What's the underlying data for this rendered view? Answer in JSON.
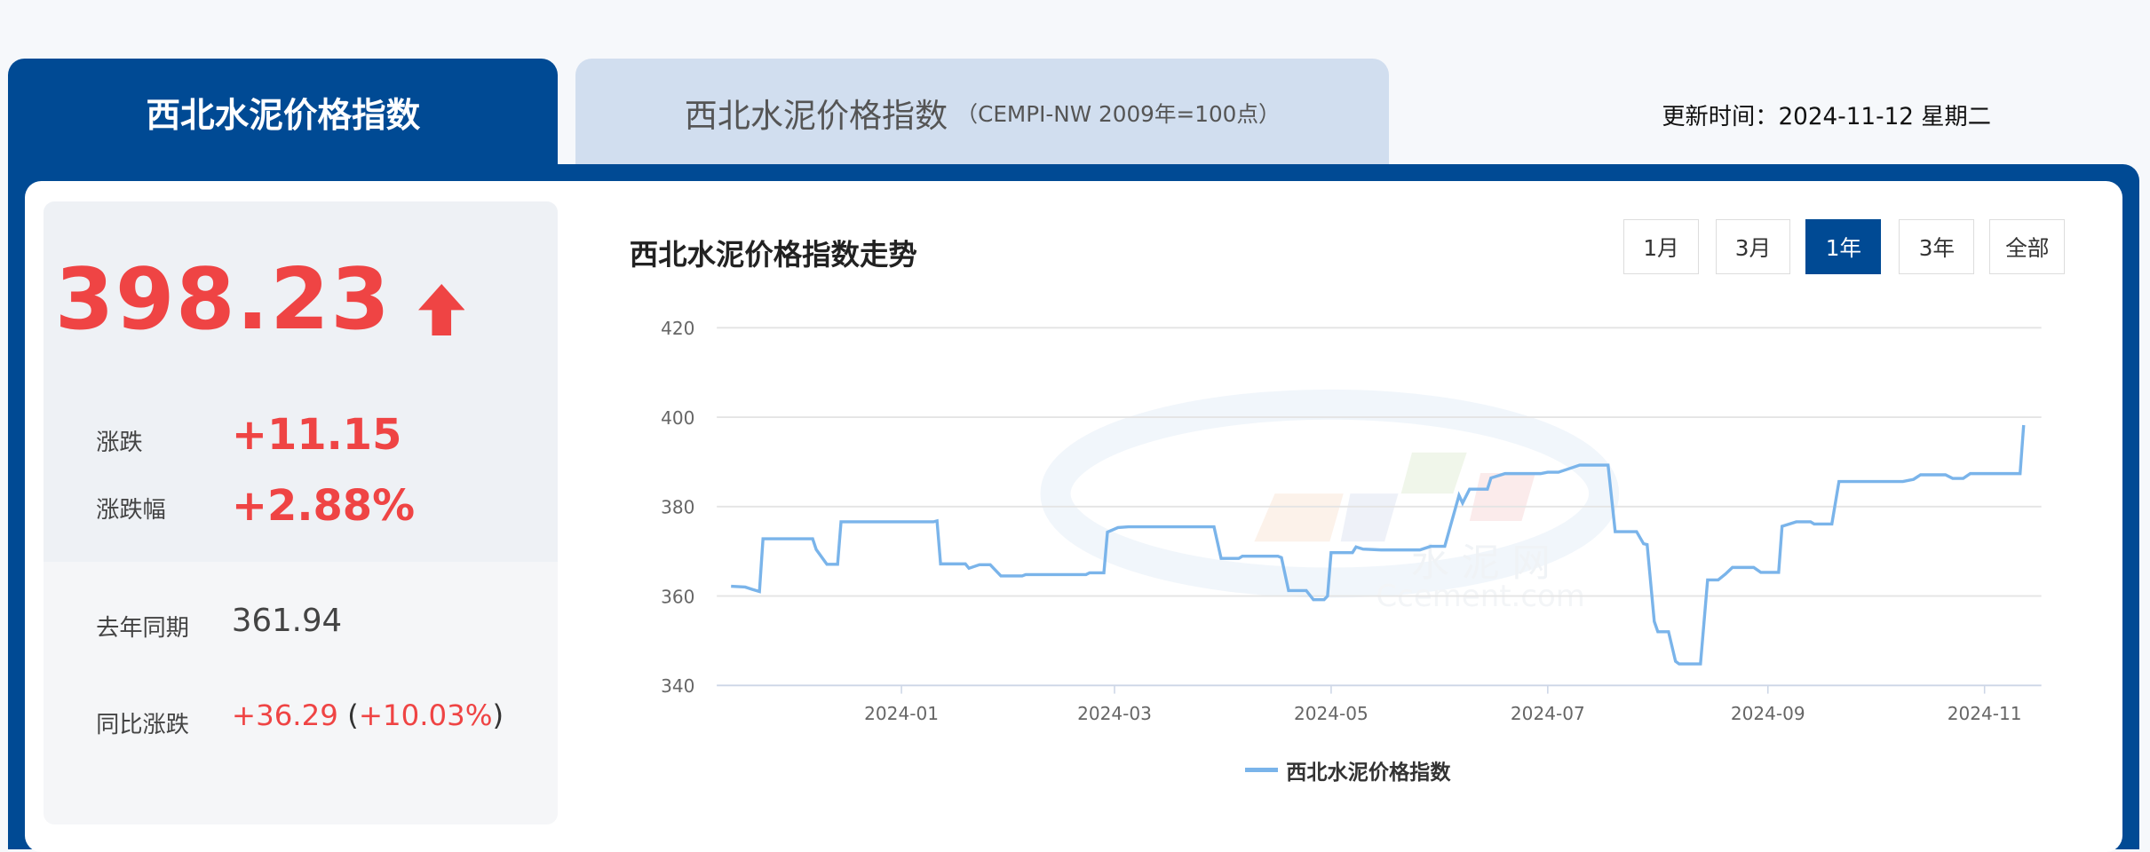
{
  "tabs": [
    {
      "label": "西北水泥价格指数",
      "active": true
    },
    {
      "label": "西北水泥价格指数",
      "sub": "（CEMPI-NW 2009年=100点）",
      "active": false
    }
  ],
  "update": "更新时间：2024-11-12 星期二",
  "summary": {
    "index": "398.23",
    "direction": "up",
    "direction_icon": "arrow-up-icon",
    "change_label": "涨跌",
    "change": "+11.15",
    "pct_label": "涨跌幅",
    "pct": "+2.88%",
    "yoy_label": "去年同期",
    "yoy": "361.94",
    "yoy_change_label": "同比涨跌",
    "yoy_change": "+36.29",
    "yoy_pct_open": " (",
    "yoy_pct": "+10.03%",
    "yoy_pct_close": ")"
  },
  "chart_title": "西北水泥价格指数走势",
  "ranges": [
    {
      "label": "1月"
    },
    {
      "label": "3月"
    },
    {
      "label": "1年",
      "active": true
    },
    {
      "label": "3年"
    },
    {
      "label": "全部"
    }
  ],
  "colors": {
    "brand": "#004a94",
    "up": "#ef4444",
    "line": "#7ab4ea"
  },
  "watermark": "水泥网 Ccement.com",
  "chart_data": {
    "type": "line",
    "title": "",
    "xlabel": "",
    "ylabel": "",
    "ylim": [
      340,
      420
    ],
    "yticks": [
      "340",
      "360",
      "380",
      "400",
      "420"
    ],
    "xlim": [
      "2023-11-10",
      "2024-11-17"
    ],
    "xticks": [
      "2024-01",
      "2024-03",
      "2024-05",
      "2024-07",
      "2024-09",
      "2024-11"
    ],
    "grid": true,
    "legend": "bottom",
    "series": [
      {
        "name": "西北水泥价格指数",
        "points": [
          [
            "2023-11-14",
            362.2
          ],
          [
            "2023-11-18",
            362.0
          ],
          [
            "2023-11-20",
            361.5
          ],
          [
            "2023-11-22",
            361.0
          ],
          [
            "2023-11-23",
            372.8
          ],
          [
            "2023-12-07",
            372.8
          ],
          [
            "2023-12-08",
            370.4
          ],
          [
            "2023-12-11",
            367.1
          ],
          [
            "2023-12-14",
            367.1
          ],
          [
            "2023-12-15",
            376.6
          ],
          [
            "2024-01-10",
            376.6
          ],
          [
            "2024-01-11",
            376.8
          ],
          [
            "2024-01-12",
            367.2
          ],
          [
            "2024-01-19",
            367.2
          ],
          [
            "2024-01-20",
            366.2
          ],
          [
            "2024-01-23",
            367.0
          ],
          [
            "2024-01-26",
            367.0
          ],
          [
            "2024-01-29",
            364.5
          ],
          [
            "2024-02-04",
            364.5
          ],
          [
            "2024-02-05",
            364.8
          ],
          [
            "2024-02-22",
            364.8
          ],
          [
            "2024-02-23",
            365.2
          ],
          [
            "2024-02-27",
            365.2
          ],
          [
            "2024-02-28",
            374.3
          ],
          [
            "2024-03-02",
            375.3
          ],
          [
            "2024-03-05",
            375.5
          ],
          [
            "2024-03-29",
            375.5
          ],
          [
            "2024-03-31",
            368.4
          ],
          [
            "2024-04-05",
            368.4
          ],
          [
            "2024-04-06",
            368.9
          ],
          [
            "2024-04-16",
            368.9
          ],
          [
            "2024-04-17",
            368.6
          ],
          [
            "2024-04-19",
            361.2
          ],
          [
            "2024-04-24",
            361.2
          ],
          [
            "2024-04-26",
            359.2
          ],
          [
            "2024-04-29",
            359.2
          ],
          [
            "2024-04-30",
            360.0
          ],
          [
            "2024-05-01",
            369.7
          ],
          [
            "2024-05-07",
            369.7
          ],
          [
            "2024-05-08",
            371.0
          ],
          [
            "2024-05-10",
            370.5
          ],
          [
            "2024-05-15",
            370.3
          ],
          [
            "2024-05-26",
            370.3
          ],
          [
            "2024-05-29",
            371.1
          ],
          [
            "2024-06-02",
            371.1
          ],
          [
            "2024-06-06",
            382.5
          ],
          [
            "2024-06-07",
            380.8
          ],
          [
            "2024-06-09",
            383.9
          ],
          [
            "2024-06-14",
            383.9
          ],
          [
            "2024-06-15",
            386.4
          ],
          [
            "2024-06-19",
            387.4
          ],
          [
            "2024-06-29",
            387.4
          ],
          [
            "2024-07-01",
            387.7
          ],
          [
            "2024-07-04",
            387.7
          ],
          [
            "2024-07-07",
            388.5
          ],
          [
            "2024-07-10",
            389.3
          ],
          [
            "2024-07-18",
            389.3
          ],
          [
            "2024-07-20",
            374.4
          ],
          [
            "2024-07-26",
            374.4
          ],
          [
            "2024-07-28",
            371.7
          ],
          [
            "2024-07-29",
            371.5
          ],
          [
            "2024-07-31",
            354.3
          ],
          [
            "2024-08-01",
            352.0
          ],
          [
            "2024-08-04",
            352.0
          ],
          [
            "2024-08-06",
            345.4
          ],
          [
            "2024-08-07",
            344.8
          ],
          [
            "2024-08-13",
            344.8
          ],
          [
            "2024-08-15",
            363.6
          ],
          [
            "2024-08-18",
            363.6
          ],
          [
            "2024-08-20",
            364.9
          ],
          [
            "2024-08-22",
            366.4
          ],
          [
            "2024-08-28",
            366.4
          ],
          [
            "2024-08-30",
            365.3
          ],
          [
            "2024-09-04",
            365.3
          ],
          [
            "2024-09-05",
            375.6
          ],
          [
            "2024-09-09",
            376.6
          ],
          [
            "2024-09-13",
            376.6
          ],
          [
            "2024-09-14",
            376.1
          ],
          [
            "2024-09-19",
            376.1
          ],
          [
            "2024-09-21",
            385.6
          ],
          [
            "2024-10-09",
            385.6
          ],
          [
            "2024-10-12",
            386.1
          ],
          [
            "2024-10-14",
            387.1
          ],
          [
            "2024-10-21",
            387.1
          ],
          [
            "2024-10-23",
            386.3
          ],
          [
            "2024-10-26",
            386.3
          ],
          [
            "2024-10-28",
            387.4
          ],
          [
            "2024-11-11",
            387.4
          ],
          [
            "2024-11-12",
            398.23
          ]
        ]
      }
    ]
  }
}
